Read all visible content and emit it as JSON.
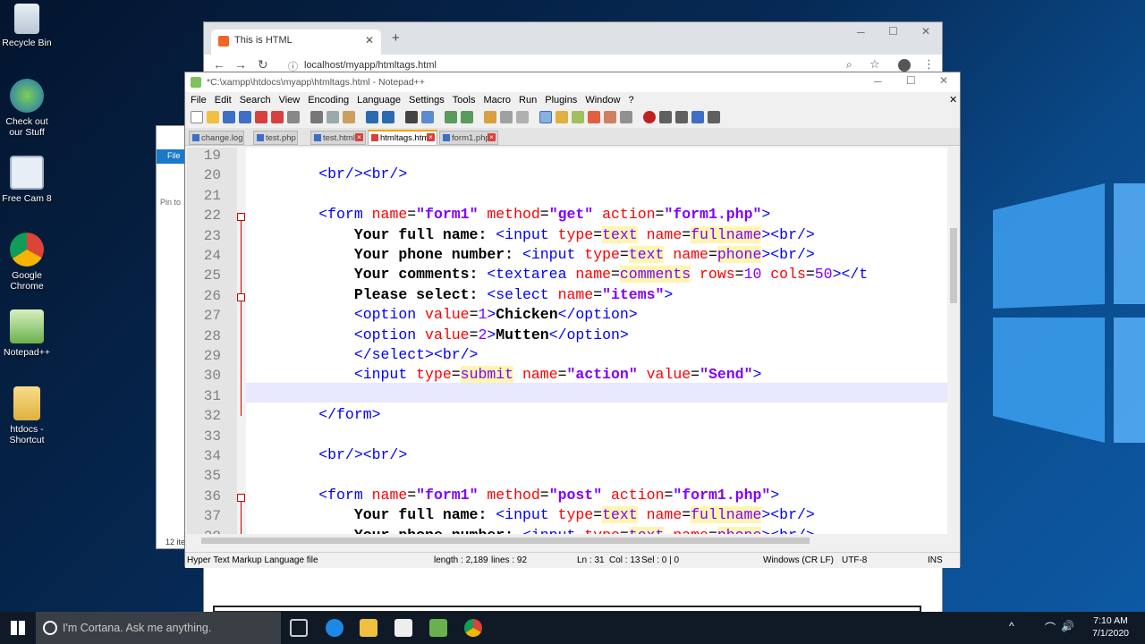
{
  "desktop": {
    "icons": [
      {
        "label": "Recycle Bin"
      },
      {
        "label": "Check out our Stuff"
      },
      {
        "label": "Free Cam 8"
      },
      {
        "label": "Google Chrome"
      },
      {
        "label": "Notepad++"
      },
      {
        "label": "htdocs - Shortcut"
      }
    ]
  },
  "chrome": {
    "tab_title": "This is HTML",
    "address": "localhost/myapp/htmltags.html"
  },
  "explorer": {
    "file_label": "File",
    "pin_text": "Pin to",
    "items_count": "12 ite"
  },
  "notepadpp": {
    "title": "*C:\\xampp\\htdocs\\myapp\\htmltags.html - Notepad++",
    "menu": [
      "File",
      "Edit",
      "Search",
      "View",
      "Encoding",
      "Language",
      "Settings",
      "Tools",
      "Macro",
      "Run",
      "Plugins",
      "Window",
      "?"
    ],
    "tabs": [
      "change.log",
      "test.php",
      "test.html",
      "htmltags.html",
      "form1.php"
    ],
    "active_tab": "htmltags.html",
    "line_numbers": [
      "19",
      "20",
      "21",
      "22",
      "23",
      "24",
      "25",
      "26",
      "27",
      "28",
      "29",
      "30",
      "31",
      "32",
      "33",
      "34",
      "35",
      "36",
      "37",
      "38"
    ],
    "status": {
      "filetype": "Hyper Text Markup Language file",
      "length": "length : 2,189",
      "lines": "lines : 92",
      "ln": "Ln : 31",
      "col": "Col : 13",
      "sel": "Sel : 0 | 0",
      "eol": "Windows (CR LF)",
      "encoding": "UTF-8",
      "mode": "INS"
    }
  },
  "taskbar": {
    "search_placeholder": "I'm Cortana. Ask me anything.",
    "time": "7:10 AM",
    "date": "7/1/2020"
  },
  "colors": {
    "tag": "#0000ff",
    "attribute": "#ff0000",
    "value": "#8000ff",
    "current_line": "#e8e8ff",
    "active_tab_accent": "#f7a100"
  }
}
